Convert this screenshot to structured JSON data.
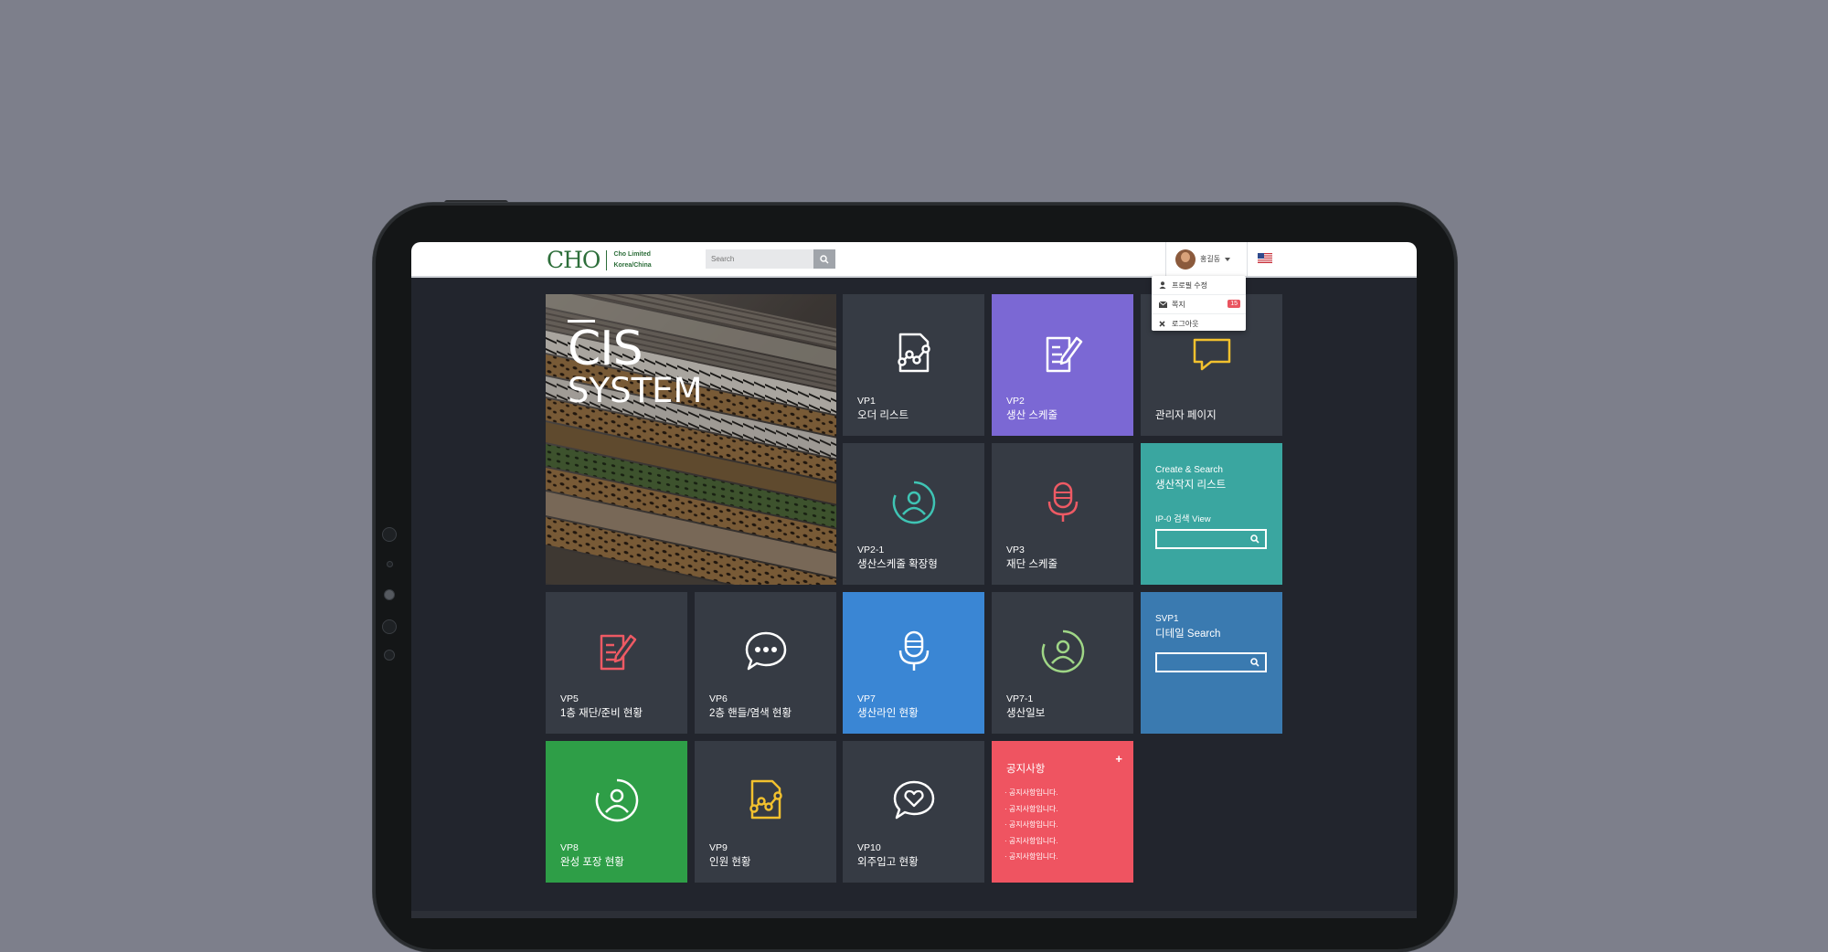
{
  "header": {
    "logo_mark": "CHO",
    "company_line1": "Cho Limited",
    "company_line2": "Korea/China",
    "search_placeholder": "Search",
    "user_name": "홍길동"
  },
  "user_menu": {
    "items": [
      {
        "icon": "user-icon",
        "label": "프로필 수정"
      },
      {
        "icon": "envelope-icon",
        "label": "쪽지",
        "badge": "15"
      },
      {
        "icon": "close-icon",
        "label": "로그아웃"
      }
    ]
  },
  "hero": {
    "title": "CIS",
    "subtitle": "SYSTEM"
  },
  "tiles": {
    "vp1": {
      "code": "VP1",
      "name": "오더 리스트",
      "icon": "document-chart-icon"
    },
    "vp2": {
      "code": "VP2",
      "name": "생산 스케줄",
      "icon": "edit-note-icon"
    },
    "admin": {
      "code": "",
      "name": "관리자 페이지",
      "icon": "chat-icon"
    },
    "vp21": {
      "code": "VP2-1",
      "name": "생산스케줄 확장형",
      "icon": "user-circle-icon"
    },
    "vp3": {
      "code": "VP3",
      "name": "재단 스케줄",
      "icon": "microphone-icon"
    },
    "vp5": {
      "code": "VP5",
      "name": "1층 재단/준비 현황",
      "icon": "edit-note-icon"
    },
    "vp6": {
      "code": "VP6",
      "name": "2층 핸들/염색 현황",
      "icon": "chat-dots-icon"
    },
    "vp7": {
      "code": "VP7",
      "name": "생산라인 현황",
      "icon": "microphone-icon"
    },
    "vp71": {
      "code": "VP7-1",
      "name": "생산일보",
      "icon": "user-circle-icon"
    },
    "vp8": {
      "code": "VP8",
      "name": "완성 포장 현황",
      "icon": "user-circle-icon"
    },
    "vp9": {
      "code": "VP9",
      "name": "인원 현황",
      "icon": "document-chart-icon"
    },
    "vp10": {
      "code": "VP10",
      "name": "외주입고 현황",
      "icon": "heart-chat-icon"
    }
  },
  "create_search": {
    "line1": "Create & Search",
    "line2": "생산작지 리스트",
    "label": "IP-0 검색 View"
  },
  "svp1": {
    "line1": "SVP1",
    "line2": "디테일 Search"
  },
  "notice": {
    "title": "공지사항",
    "plus": "+",
    "items": [
      "공지사항입니다.",
      "공지사항입니다.",
      "공지사항입니다.",
      "공지사항입니다.",
      "공지사항입니다."
    ]
  },
  "colors": {
    "background": "#7d7f8b",
    "tile_dark": "#363b44",
    "purple": "#7b68d4",
    "teal": "#3aa6a0",
    "steel_blue": "#3a7ab0",
    "blue": "#3a86d4",
    "green": "#2e9e47",
    "red": "#ef5461",
    "logo_green": "#2d6e3a"
  }
}
